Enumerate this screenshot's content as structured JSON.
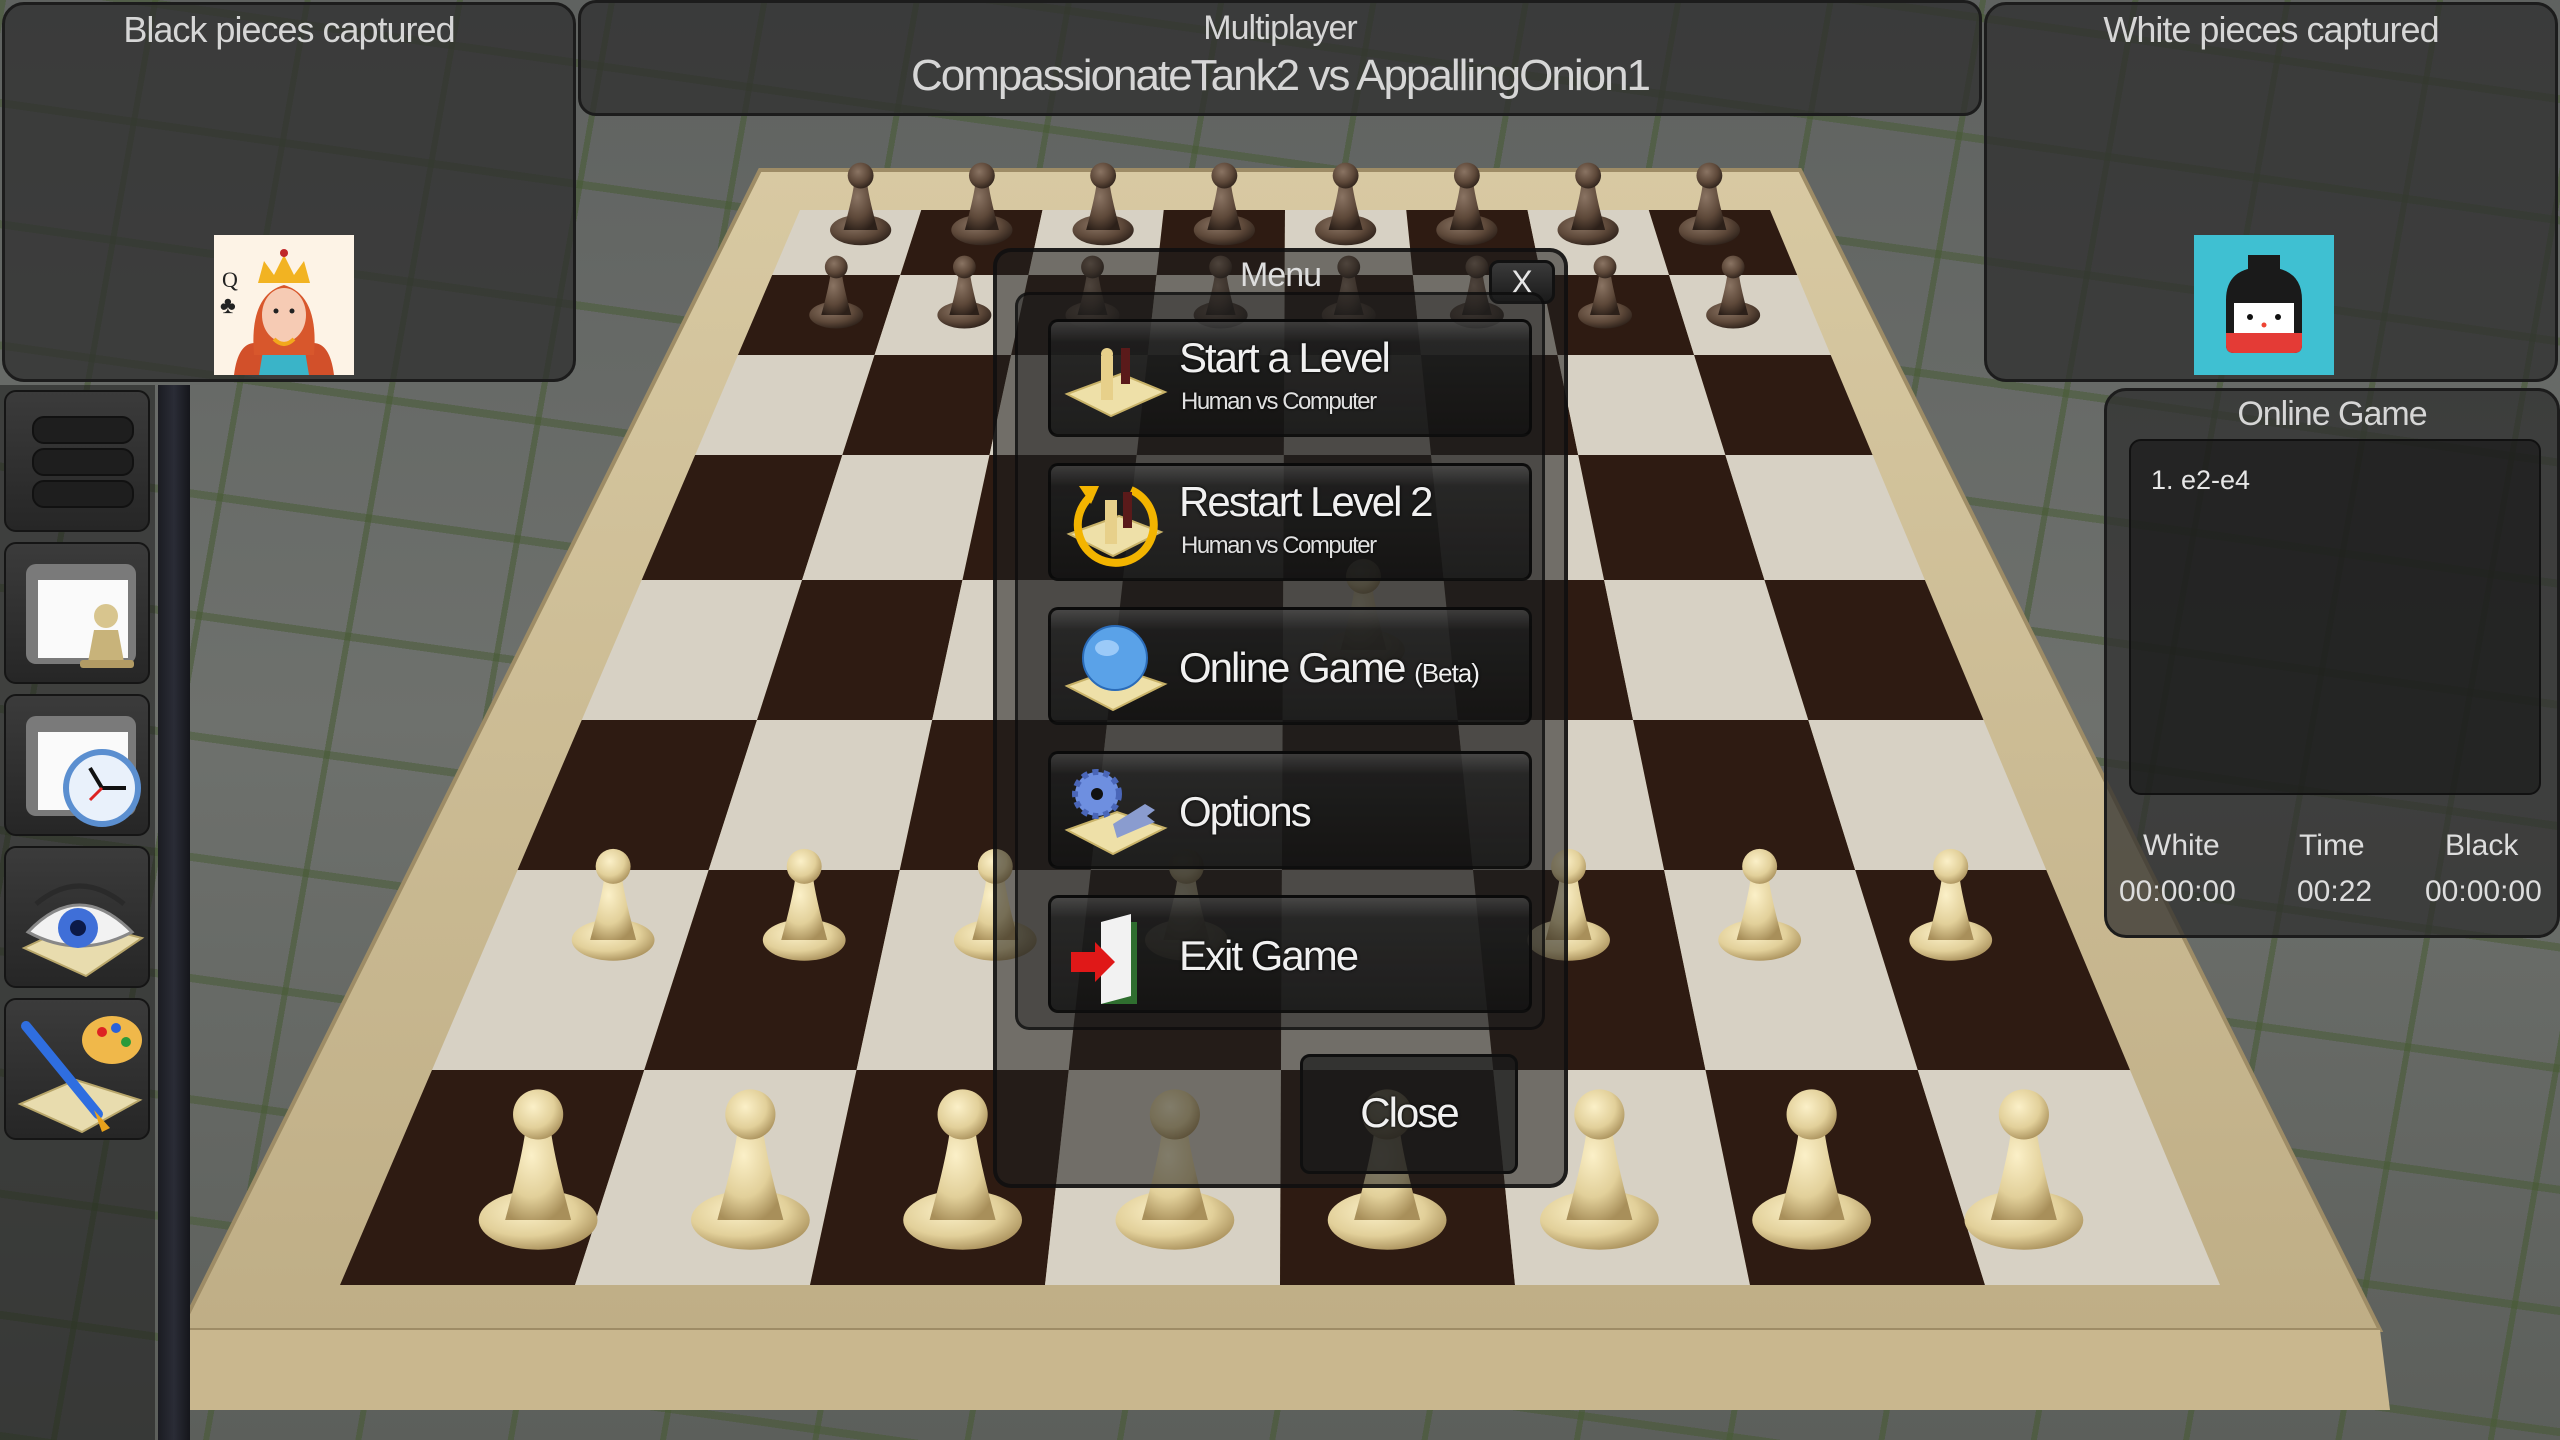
{
  "top_left_panel": {
    "title": "Black pieces captured",
    "captured_avatar": "queen-of-clubs-card-avatar"
  },
  "top_center_panel": {
    "mode": "Multiplayer",
    "matchup": "CompassionateTank2 vs AppallingOnion1"
  },
  "top_right_panel": {
    "title": "White pieces captured",
    "captured_avatar": "kokeshi-doll-avatar"
  },
  "online_panel": {
    "title": "Online Game",
    "moves": [
      "1. e2-e4"
    ],
    "clock_headers": {
      "white": "White",
      "time": "Time",
      "black": "Black"
    },
    "clock_values": {
      "white": "00:00:00",
      "time": "00:22",
      "black": "00:00:00"
    }
  },
  "sidebar": {
    "items": [
      {
        "icon": "hamburger-menu-icon"
      },
      {
        "icon": "window-pawn-icon"
      },
      {
        "icon": "window-clock-icon"
      },
      {
        "icon": "eye-board-icon"
      },
      {
        "icon": "paintbrush-palette-icon"
      }
    ]
  },
  "menu": {
    "title": "Menu",
    "close_x": "X",
    "items": [
      {
        "label": "Start a Level",
        "sub": "Human vs Computer",
        "icon": "chess-board-icon"
      },
      {
        "label": "Restart Level 2",
        "sub": "Human vs Computer",
        "icon": "restart-board-icon"
      },
      {
        "label": "Online Game",
        "suffix": "(Beta)",
        "icon": "globe-board-icon"
      },
      {
        "label": "Options",
        "icon": "gear-wrench-icon"
      },
      {
        "label": "Exit Game",
        "icon": "exit-door-icon"
      }
    ],
    "close_label": "Close"
  },
  "colors": {
    "board_dark": "#2e1b12",
    "board_light": "#d7d1c4",
    "frame": "#cbb88f",
    "white_piece": "#e4d4a0",
    "black_piece": "#5a4636"
  }
}
